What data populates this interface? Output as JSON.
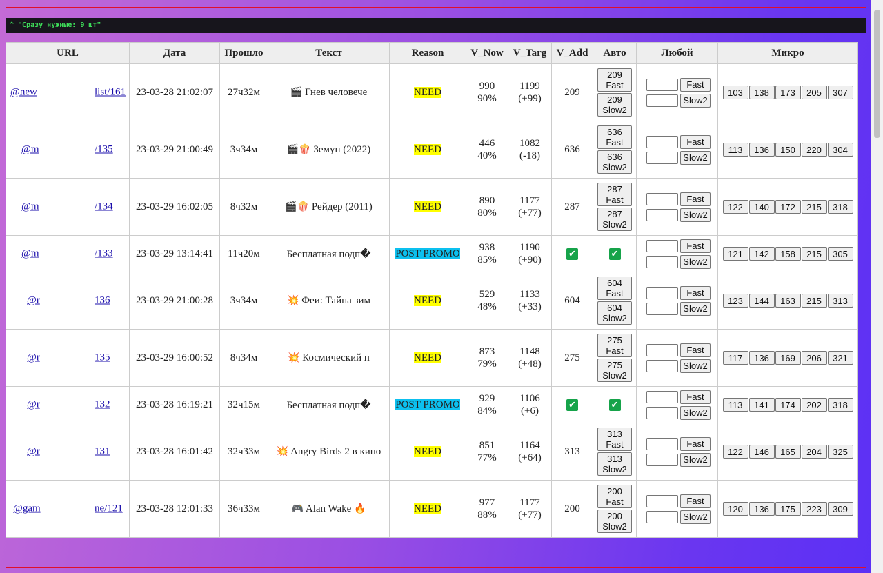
{
  "console": {
    "text": "^ \"Сразу нужные: 9 шт\""
  },
  "headers": {
    "url": "URL",
    "date": "Дата",
    "elapsed": "Прошло",
    "text": "Текст",
    "reason": "Reason",
    "v_now": "V_Now",
    "v_targ": "V_Targ",
    "v_add": "V_Add",
    "auto": "Авто",
    "any": "Любой",
    "micro": "Микро"
  },
  "rows": [
    {
      "url_left": "@new",
      "url_right": "list/161",
      "date": "23-03-28 21:02:07",
      "elapsed": "27ч32м",
      "icons": "🎬",
      "text": "Гнев человече",
      "text_suffix": "",
      "reason": "NEED",
      "v_now": "990",
      "v_now_pct": "90%",
      "v_targ": "1199",
      "v_targ_diff": "(+99)",
      "v_add": "209",
      "auto_fast": "209 Fast",
      "auto_slow": "209 Slow2",
      "any_fast": "Fast",
      "any_slow": "Slow2",
      "micro": [
        "103",
        "138",
        "173",
        "205",
        "307"
      ]
    },
    {
      "url_left": "@m",
      "url_right": "/135",
      "date": "23-03-29 21:00:49",
      "elapsed": "3ч34м",
      "icons": "🎬🍿",
      "text": "Земун (2022)",
      "text_suffix": "",
      "reason": "NEED",
      "v_now": "446",
      "v_now_pct": "40%",
      "v_targ": "1082",
      "v_targ_diff": "(-18)",
      "v_add": "636",
      "auto_fast": "636 Fast",
      "auto_slow": "636 Slow2",
      "any_fast": "Fast",
      "any_slow": "Slow2",
      "micro": [
        "113",
        "136",
        "150",
        "220",
        "304"
      ]
    },
    {
      "url_left": "@m",
      "url_right": "/134",
      "date": "23-03-29 16:02:05",
      "elapsed": "8ч32м",
      "icons": "🎬🍿",
      "text": "Рейдер (2011)",
      "text_suffix": "",
      "reason": "NEED",
      "v_now": "890",
      "v_now_pct": "80%",
      "v_targ": "1177",
      "v_targ_diff": "(+77)",
      "v_add": "287",
      "auto_fast": "287 Fast",
      "auto_slow": "287 Slow2",
      "any_fast": "Fast",
      "any_slow": "Slow2",
      "micro": [
        "122",
        "140",
        "172",
        "215",
        "318"
      ]
    },
    {
      "url_left": "@m",
      "url_right": "/133",
      "date": "23-03-29 13:14:41",
      "elapsed": "11ч20м",
      "icons": "",
      "text": "Бесплатная подп�",
      "text_suffix": "",
      "reason": "POST PROMO",
      "v_now": "938",
      "v_now_pct": "85%",
      "v_targ": "1190",
      "v_targ_diff": "(+90)",
      "v_add": "✔",
      "auto_check": "✔",
      "any_fast": "Fast",
      "any_slow": "Slow2",
      "micro": [
        "121",
        "142",
        "158",
        "215",
        "305"
      ]
    },
    {
      "url_left": "@r",
      "url_right": "136",
      "date": "23-03-29 21:00:28",
      "elapsed": "3ч34м",
      "icons": "💥",
      "text": "Феи: Тайна зим",
      "text_suffix": "",
      "reason": "NEED",
      "v_now": "529",
      "v_now_pct": "48%",
      "v_targ": "1133",
      "v_targ_diff": "(+33)",
      "v_add": "604",
      "auto_fast": "604 Fast",
      "auto_slow": "604 Slow2",
      "any_fast": "Fast",
      "any_slow": "Slow2",
      "micro": [
        "123",
        "144",
        "163",
        "215",
        "313"
      ]
    },
    {
      "url_left": "@r",
      "url_right": "135",
      "date": "23-03-29 16:00:52",
      "elapsed": "8ч34м",
      "icons": "💥",
      "text": "Космический п",
      "text_suffix": "",
      "reason": "NEED",
      "v_now": "873",
      "v_now_pct": "79%",
      "v_targ": "1148",
      "v_targ_diff": "(+48)",
      "v_add": "275",
      "auto_fast": "275 Fast",
      "auto_slow": "275 Slow2",
      "any_fast": "Fast",
      "any_slow": "Slow2",
      "micro": [
        "117",
        "136",
        "169",
        "206",
        "321"
      ]
    },
    {
      "url_left": "@r",
      "url_right": "132",
      "date": "23-03-28 16:19:21",
      "elapsed": "32ч15м",
      "icons": "",
      "text": "Бесплатная подп�",
      "text_suffix": "",
      "reason": "POST PROMO",
      "v_now": "929",
      "v_now_pct": "84%",
      "v_targ": "1106",
      "v_targ_diff": "(+6)",
      "v_add": "✔",
      "auto_check": "✔",
      "any_fast": "Fast",
      "any_slow": "Slow2",
      "micro": [
        "113",
        "141",
        "174",
        "202",
        "318"
      ]
    },
    {
      "url_left": "@r",
      "url_right": "131",
      "date": "23-03-28 16:01:42",
      "elapsed": "32ч33м",
      "icons": "💥",
      "text": "Angry Birds 2 в кино",
      "text_suffix": "",
      "reason": "NEED",
      "v_now": "851",
      "v_now_pct": "77%",
      "v_targ": "1164",
      "v_targ_diff": "(+64)",
      "v_add": "313",
      "auto_fast": "313 Fast",
      "auto_slow": "313 Slow2",
      "any_fast": "Fast",
      "any_slow": "Slow2",
      "micro": [
        "122",
        "146",
        "165",
        "204",
        "325"
      ]
    },
    {
      "url_left": "@gam",
      "url_right": "ne/121",
      "date": "23-03-28 12:01:33",
      "elapsed": "36ч33м",
      "icons": "🎮",
      "text": "Alan Wake",
      "text_suffix": "🔥",
      "reason": "NEED",
      "v_now": "977",
      "v_now_pct": "88%",
      "v_targ": "1177",
      "v_targ_diff": "(+77)",
      "v_add": "200",
      "auto_fast": "200 Fast",
      "auto_slow": "200 Slow2",
      "any_fast": "Fast",
      "any_slow": "Slow2",
      "micro": [
        "120",
        "136",
        "175",
        "223",
        "309"
      ]
    }
  ]
}
